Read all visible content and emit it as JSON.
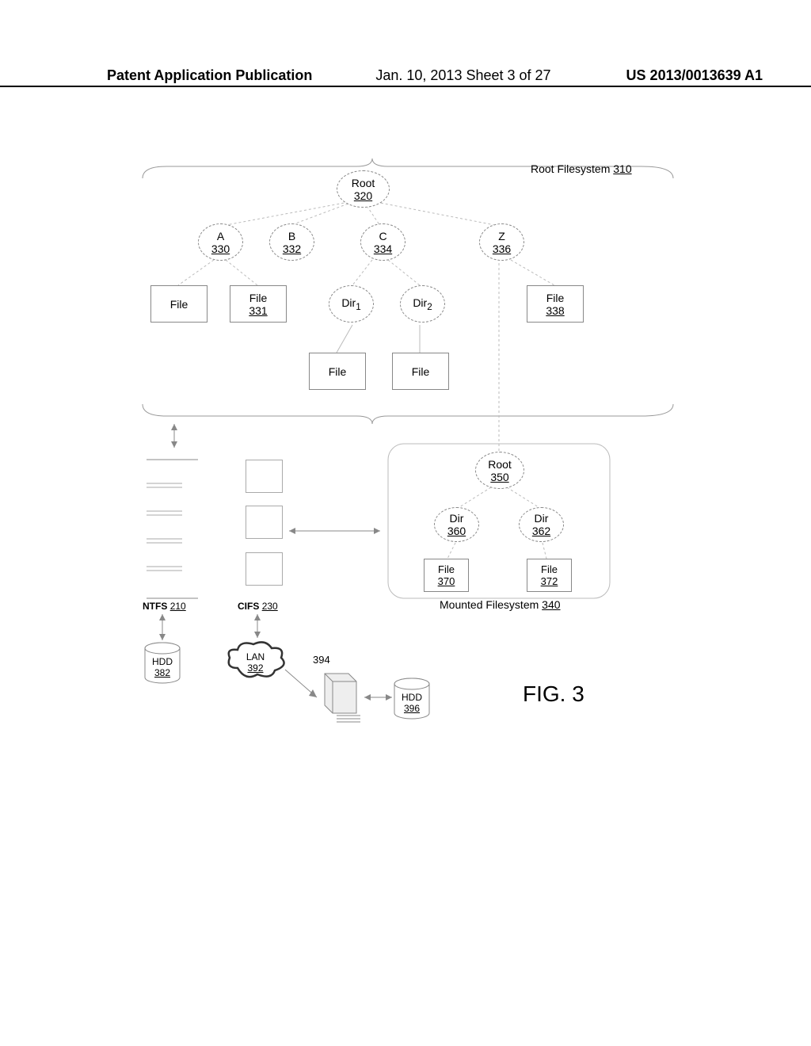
{
  "header": {
    "left": "Patent Application Publication",
    "center": "Jan. 10, 2013  Sheet 3 of 27",
    "right": "US 2013/0013639 A1"
  },
  "rootfs_label": "Root Filesystem",
  "rootfs_num": "310",
  "root": {
    "name": "Root",
    "num": "320"
  },
  "driveA": {
    "name": "A",
    "num": "330"
  },
  "driveB": {
    "name": "B",
    "num": "332"
  },
  "driveC": {
    "name": "C",
    "num": "334"
  },
  "driveZ": {
    "name": "Z",
    "num": "336"
  },
  "file_plain": "File",
  "file331": {
    "name": "File",
    "num": "331"
  },
  "dir1": "Dir",
  "dir1_sub": "1",
  "dir2": "Dir",
  "dir2_sub": "2",
  "file338": {
    "name": "File",
    "num": "338"
  },
  "ntfs": {
    "name": "NTFS",
    "num": "210"
  },
  "cifs": {
    "name": "CIFS",
    "num": "230"
  },
  "mounted": {
    "label": "Mounted Filesystem",
    "num": "340"
  },
  "root2": {
    "name": "Root",
    "num": "350"
  },
  "dir360": {
    "name": "Dir",
    "num": "360"
  },
  "dir362": {
    "name": "Dir",
    "num": "362"
  },
  "file370": {
    "name": "File",
    "num": "370"
  },
  "file372": {
    "name": "File",
    "num": "372"
  },
  "hdd382": {
    "name": "HDD",
    "num": "382"
  },
  "lan392": {
    "name": "LAN",
    "num": "392"
  },
  "server394": "394",
  "hdd396": {
    "name": "HDD",
    "num": "396"
  },
  "figure": "FIG. 3"
}
